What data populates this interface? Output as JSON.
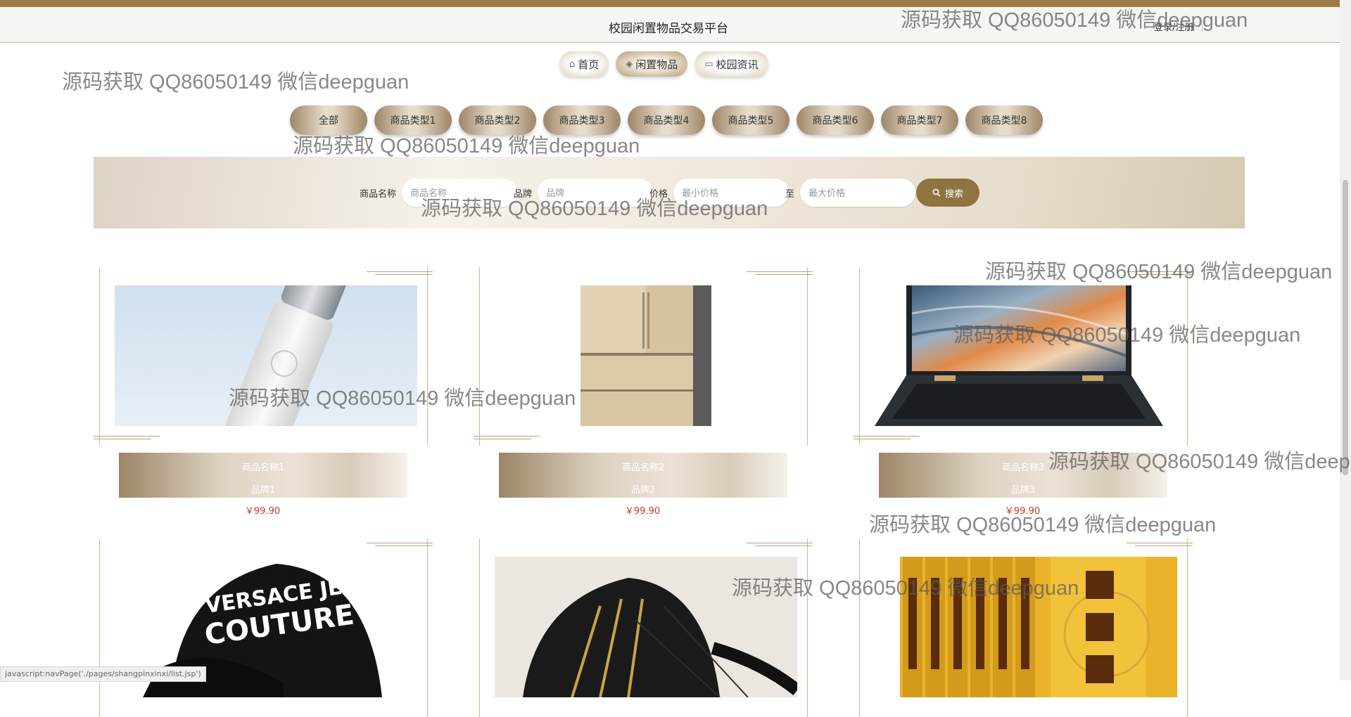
{
  "header": {
    "site_title": "校园闲置物品交易平台",
    "login": "登录/注册"
  },
  "nav": [
    {
      "icon": "home-icon",
      "glyph": "⌂",
      "label": "首页",
      "active": false
    },
    {
      "icon": "layers-icon",
      "glyph": "◈",
      "label": "闲置物品",
      "active": true
    },
    {
      "icon": "book-icon",
      "glyph": "▭",
      "label": "校园资讯",
      "active": false
    }
  ],
  "categories": [
    "全部",
    "商品类型1",
    "商品类型2",
    "商品类型3",
    "商品类型4",
    "商品类型5",
    "商品类型6",
    "商品类型7",
    "商品类型8"
  ],
  "search": {
    "name_label": "商品名称",
    "name_placeholder": "商品名称",
    "brand_label": "品牌",
    "brand_placeholder": "品牌",
    "price_label": "价格",
    "min_placeholder": "最小价格",
    "to_label": "至",
    "max_placeholder": "最大价格",
    "button": "搜索"
  },
  "products": [
    {
      "name": "商品名称1",
      "brand": "品牌1",
      "price": "￥99.90"
    },
    {
      "name": "商品名称2",
      "brand": "品牌2",
      "price": "￥99.90"
    },
    {
      "name": "商品名称3",
      "brand": "品牌3",
      "price": "￥99.90"
    },
    {
      "name": "",
      "brand": "",
      "price": ""
    },
    {
      "name": "",
      "brand": "",
      "price": ""
    },
    {
      "name": "",
      "brand": "",
      "price": ""
    }
  ],
  "status_bar": "javascript:navPage('./pages/shangpinxinxi/list.jsp')",
  "watermark": "源码获取 QQ86050149 微信deepguan",
  "colors": {
    "accent": "#8d7440",
    "topbar": "#9a7a45",
    "price": "#c0392b"
  }
}
